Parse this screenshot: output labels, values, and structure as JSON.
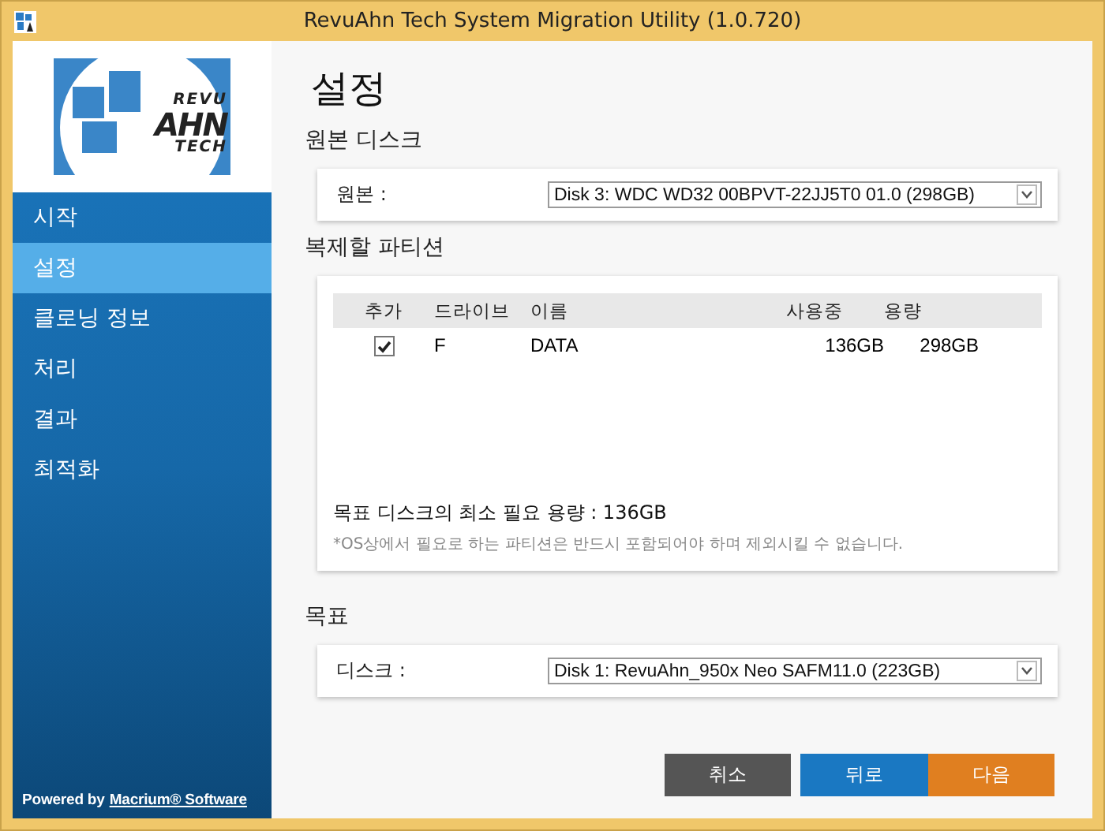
{
  "window": {
    "title": "RevuAhn Tech System Migration Utility (1.0.720)"
  },
  "logo": {
    "lines": [
      "REVU",
      "AHN",
      "TECH"
    ]
  },
  "sidebar": {
    "items": [
      {
        "label": "시작",
        "selected": false
      },
      {
        "label": "설정",
        "selected": true
      },
      {
        "label": "클로닝 정보",
        "selected": false
      },
      {
        "label": "처리",
        "selected": false
      },
      {
        "label": "결과",
        "selected": false
      },
      {
        "label": "최적화",
        "selected": false
      }
    ],
    "footer": {
      "text": "Powered by",
      "link": "Macrium® Software"
    }
  },
  "heading": "설정",
  "source": {
    "title": "원본 디스크",
    "label": "원본 :",
    "value": "Disk 3: WDC WD32 00BPVT-22JJ5T0 01.0 (298GB)"
  },
  "partitions": {
    "title": "복제할 파티션",
    "columns": [
      "추가",
      "드라이브",
      "이름",
      "사용중",
      "용량"
    ],
    "rows": [
      {
        "checked": true,
        "drive": "F",
        "name": "DATA",
        "used": "136GB",
        "size": "298GB"
      }
    ],
    "required": "목표 디스크의 최소 필요 용량 : 136GB",
    "note": "*OS상에서 필요로 하는 파티션은 반드시 포함되어야 하며 제외시킬 수 없습니다."
  },
  "target": {
    "title": "목표",
    "label": "디스크 :",
    "value": "Disk 1: RevuAhn_950x Neo SAFM11.0 (223GB)"
  },
  "buttons": [
    {
      "label": "취소",
      "kind": "cancel"
    },
    {
      "label": "뒤로",
      "kind": "back"
    },
    {
      "label": "다음",
      "kind": "next"
    }
  ]
}
